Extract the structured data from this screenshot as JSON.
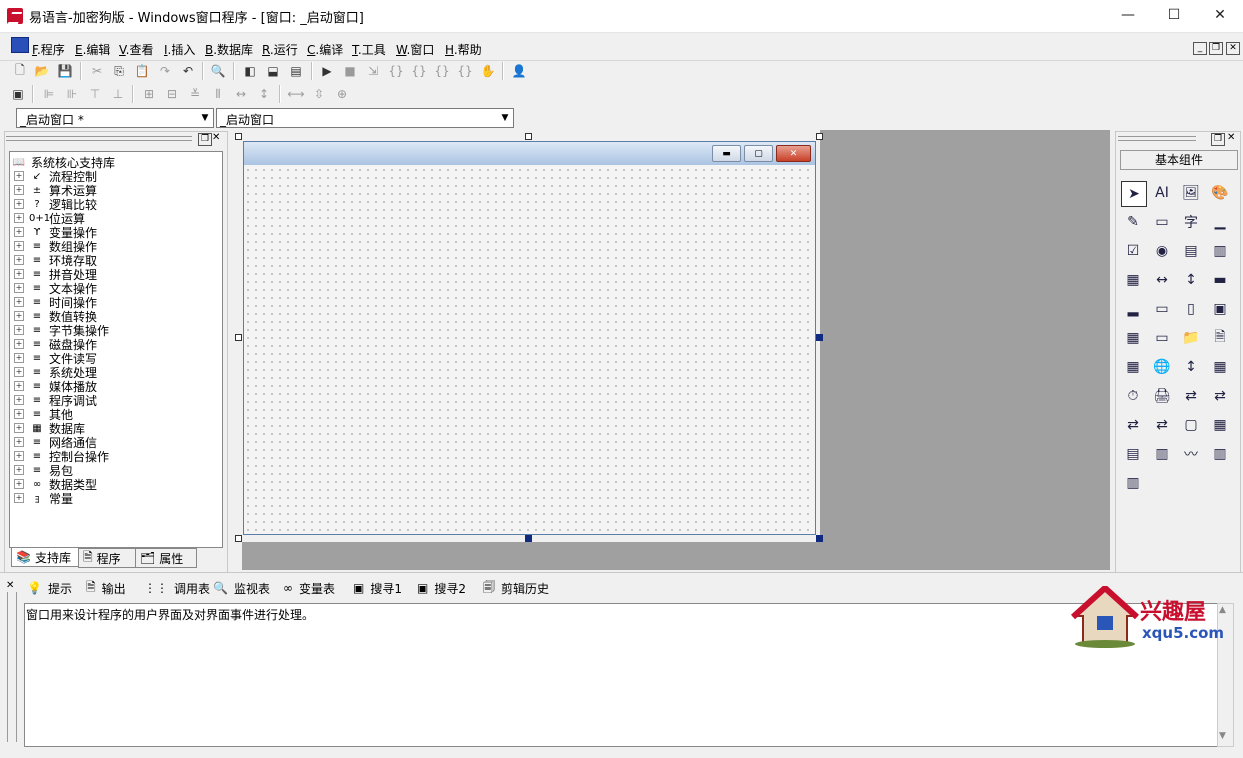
{
  "window": {
    "title": "易语言-加密狗版 - Windows窗口程序 - [窗口: _启动窗口]",
    "minimize": "—",
    "maximize": "☐",
    "close": "✕"
  },
  "menu": [
    {
      "key": "F",
      "label": ".程序"
    },
    {
      "key": "E",
      "label": ".编辑"
    },
    {
      "key": "V",
      "label": ".查看"
    },
    {
      "key": "I",
      "label": ".插入"
    },
    {
      "key": "B",
      "label": ".数据库"
    },
    {
      "key": "R",
      "label": ".运行"
    },
    {
      "key": "C",
      "label": ".编译"
    },
    {
      "key": "T",
      "label": ".工具"
    },
    {
      "key": "W",
      "label": ".窗口"
    },
    {
      "key": "H",
      "label": ".帮助"
    }
  ],
  "selectors": {
    "object_combo": "_启动窗口 *",
    "event_combo": "_启动窗口"
  },
  "tree": {
    "root": "系统核心支持库",
    "items": [
      {
        "icon": "↙",
        "label": "流程控制"
      },
      {
        "icon": "±",
        "label": "算术运算"
      },
      {
        "icon": "?",
        "label": "逻辑比较"
      },
      {
        "icon": "0+1",
        "label": "位运算"
      },
      {
        "icon": "ϒ",
        "label": "变量操作"
      },
      {
        "icon": "≡",
        "label": "数组操作"
      },
      {
        "icon": "≡",
        "label": "环境存取"
      },
      {
        "icon": "≡",
        "label": "拼音处理"
      },
      {
        "icon": "≡",
        "label": "文本操作"
      },
      {
        "icon": "≡",
        "label": "时间操作"
      },
      {
        "icon": "≡",
        "label": "数值转换"
      },
      {
        "icon": "≡",
        "label": "字节集操作"
      },
      {
        "icon": "≡",
        "label": "磁盘操作"
      },
      {
        "icon": "≡",
        "label": "文件读写"
      },
      {
        "icon": "≡",
        "label": "系统处理"
      },
      {
        "icon": "≡",
        "label": "媒体播放"
      },
      {
        "icon": "≡",
        "label": "程序调试"
      },
      {
        "icon": "≡",
        "label": "其他"
      },
      {
        "icon": "▦",
        "label": "数据库"
      },
      {
        "icon": "≡",
        "label": "网络通信"
      },
      {
        "icon": "≡",
        "label": "控制台操作"
      },
      {
        "icon": "≡",
        "label": "易包"
      },
      {
        "icon": "∞",
        "label": "数据类型"
      },
      {
        "icon": "ﾖ",
        "label": "常量"
      }
    ]
  },
  "left_tabs": [
    "支持库",
    "程序",
    "属性"
  ],
  "components_panel": {
    "title": "基本组件"
  },
  "output_tabs": [
    "提示",
    "输出",
    "调用表",
    "监视表",
    "变量表",
    "搜寻1",
    "搜寻2",
    "剪辑历史"
  ],
  "hint_text": "窗口用来设计程序的用户界面及对界面事件进行处理。",
  "watermark": {
    "name": "兴趣屋",
    "url": "xqu5.com"
  }
}
